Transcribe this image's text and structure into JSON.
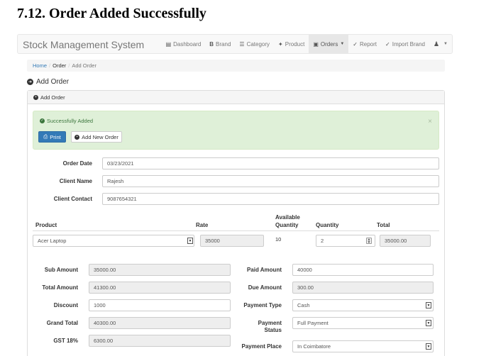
{
  "doc_heading": "7.12. Order Added Successfully",
  "navbar": {
    "brand": "Stock Management System",
    "items": [
      {
        "label": "Dashboard",
        "icon": "list-icon"
      },
      {
        "label": "Brand",
        "icon": "bold-b-icon"
      },
      {
        "label": "Category",
        "icon": "th-list-icon"
      },
      {
        "label": "Product",
        "icon": "pushpin-icon"
      },
      {
        "label": "Orders",
        "icon": "cart-icon"
      },
      {
        "label": "Report",
        "icon": "check-icon"
      },
      {
        "label": "Import Brand",
        "icon": "check-icon"
      }
    ],
    "user_icon": "user-icon"
  },
  "breadcrumb": {
    "home": "Home",
    "order": "Order",
    "current": "Add Order"
  },
  "page_title": "Add Order",
  "panel_heading": "Add Order",
  "alert": {
    "message": "Successfully Added",
    "close": "×"
  },
  "buttons": {
    "print": "Print",
    "add_new_order": "Add New Order"
  },
  "form": {
    "order_date_label": "Order Date",
    "order_date": "03/23/2021",
    "client_name_label": "Client Name",
    "client_name": "Rajesh",
    "client_contact_label": "Client Contact",
    "client_contact": "9087654321"
  },
  "table": {
    "headers": {
      "product": "Product",
      "rate": "Rate",
      "available_line1": "Available",
      "available_line2": "Quantity",
      "quantity": "Quantity",
      "total": "Total"
    },
    "row": {
      "product": "Acer Laptop",
      "rate": "35000",
      "available": "10",
      "quantity": "2",
      "total": "35000.00"
    }
  },
  "summary": {
    "sub_amount_label": "Sub Amount",
    "sub_amount": "35000.00",
    "total_amount_label": "Total Amount",
    "total_amount": "41300.00",
    "discount_label": "Discount",
    "discount": "1000",
    "grand_total_label": "Grand Total",
    "grand_total": "40300.00",
    "gst_label": "GST 18%",
    "gst": "6300.00",
    "paid_amount_label": "Paid Amount",
    "paid_amount": "40000",
    "due_amount_label": "Due Amount",
    "due_amount": "300.00",
    "payment_type_label": "Payment Type",
    "payment_type": "Cash",
    "payment_status_label_1": "Payment",
    "payment_status_label_2": "Status",
    "payment_status": "Full Payment",
    "payment_place_label": "Payment Place",
    "payment_place": "In Coimbatore"
  }
}
